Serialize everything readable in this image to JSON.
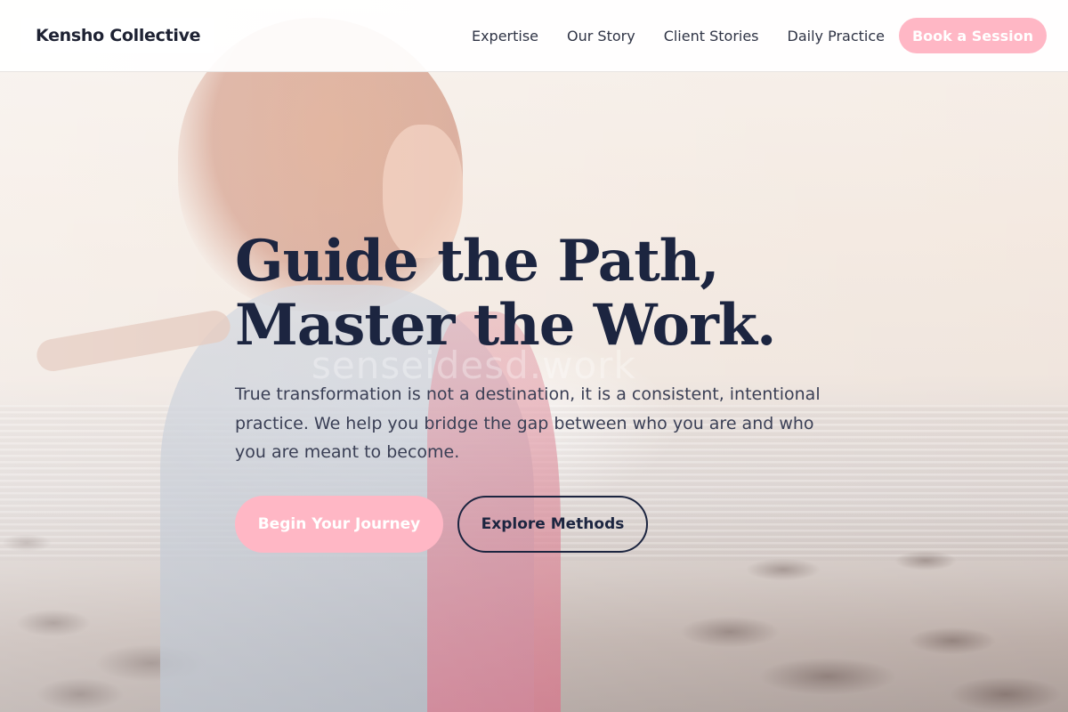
{
  "brand": {
    "name": "Kensho Collective"
  },
  "nav": {
    "items": [
      {
        "label": "Expertise"
      },
      {
        "label": "Our Story"
      },
      {
        "label": "Client Stories"
      },
      {
        "label": "Daily Practice"
      }
    ],
    "cta_label": "Book a Session"
  },
  "hero": {
    "headline_line1": "Guide the Path,",
    "headline_line2": "Master the Work.",
    "subtext": "True transformation is not a destination, it is a consistent, intentional practice. We help you bridge the gap between who you are and who you are meant to become.",
    "watermark": "senseidesd.work",
    "primary_cta": "Begin Your Journey",
    "secondary_cta": "Explore Methods"
  },
  "colors": {
    "accent_pink": "#ffb7c5",
    "navy": "#1c2540",
    "body_text": "#3a3f55"
  }
}
